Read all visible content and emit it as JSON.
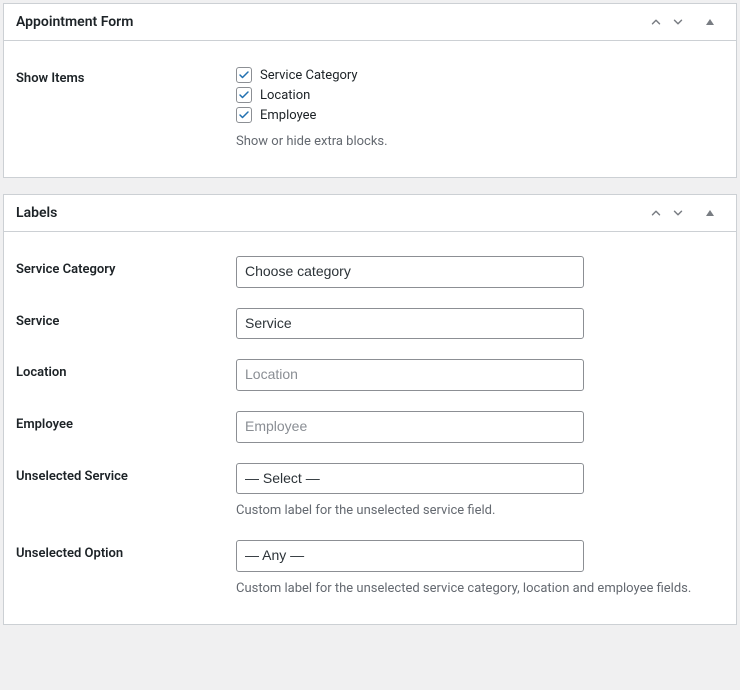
{
  "panels": {
    "appointment": {
      "title": "Appointment Form",
      "showItems": {
        "label": "Show Items",
        "options": {
          "serviceCategory": "Service Category",
          "location": "Location",
          "employee": "Employee"
        },
        "description": "Show or hide extra blocks."
      }
    },
    "labels": {
      "title": "Labels",
      "rows": {
        "serviceCategory": {
          "label": "Service Category",
          "value": "Choose category"
        },
        "service": {
          "label": "Service",
          "value": "Service"
        },
        "location": {
          "label": "Location",
          "placeholder": "Location"
        },
        "employee": {
          "label": "Employee",
          "placeholder": "Employee"
        },
        "unselectedService": {
          "label": "Unselected Service",
          "value": "— Select —",
          "description": "Custom label for the unselected service field."
        },
        "unselectedOption": {
          "label": "Unselected Option",
          "value": "— Any —",
          "description": "Custom label for the unselected service category, location and employee fields."
        }
      }
    }
  },
  "colors": {
    "check": "#2271b1"
  }
}
